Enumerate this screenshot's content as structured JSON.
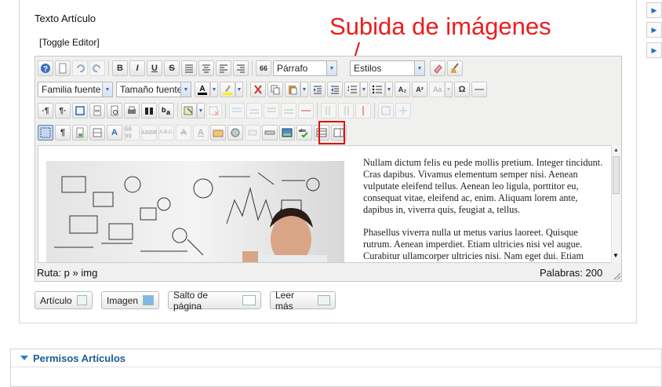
{
  "field": {
    "label": "Texto Artículo",
    "toggle": "[Toggle Editor]"
  },
  "annotation": {
    "text": "Subida de imágenes",
    "color": "#ee1c1c"
  },
  "toolbar": {
    "format": "Párrafo",
    "styles": "Estilos",
    "font_family": "Familia fuente",
    "font_size": "Tamaño fuente",
    "bold": "B",
    "italic": "I",
    "underline": "U",
    "strike": "S",
    "quote": "66",
    "subscript": "A₂",
    "superscript": "A²",
    "omega": "Ω",
    "abbr1": "ABBR",
    "abbr2": "A.B.C.",
    "spell": "abc"
  },
  "content": {
    "para1": "Nullam dictum felis eu pede mollis pretium. Integer tincidunt. Cras dapibus. Vivamus elementum semper nisi. Aenean vulputate eleifend tellus. Aenean leo ligula, porttitor eu, consequat vitae, eleifend ac, enim. Aliquam lorem ante, dapibus in, viverra quis, feugiat a, tellus.",
    "para2": "Phasellus viverra nulla ut metus varius laoreet. Quisque rutrum. Aenean imperdiet. Etiam ultricies nisi vel augue. Curabitur ullamcorper ultricies nisi. Nam eget dui. Etiam rhoncus."
  },
  "status": {
    "path": "Ruta:  p » img",
    "words": "Palabras: 200"
  },
  "buttons": {
    "article": "Artículo",
    "image": "Imagen",
    "pagebreak": "Salto de página",
    "readmore": "Leer más"
  },
  "permissions": {
    "title": "Permisos Artículos"
  }
}
